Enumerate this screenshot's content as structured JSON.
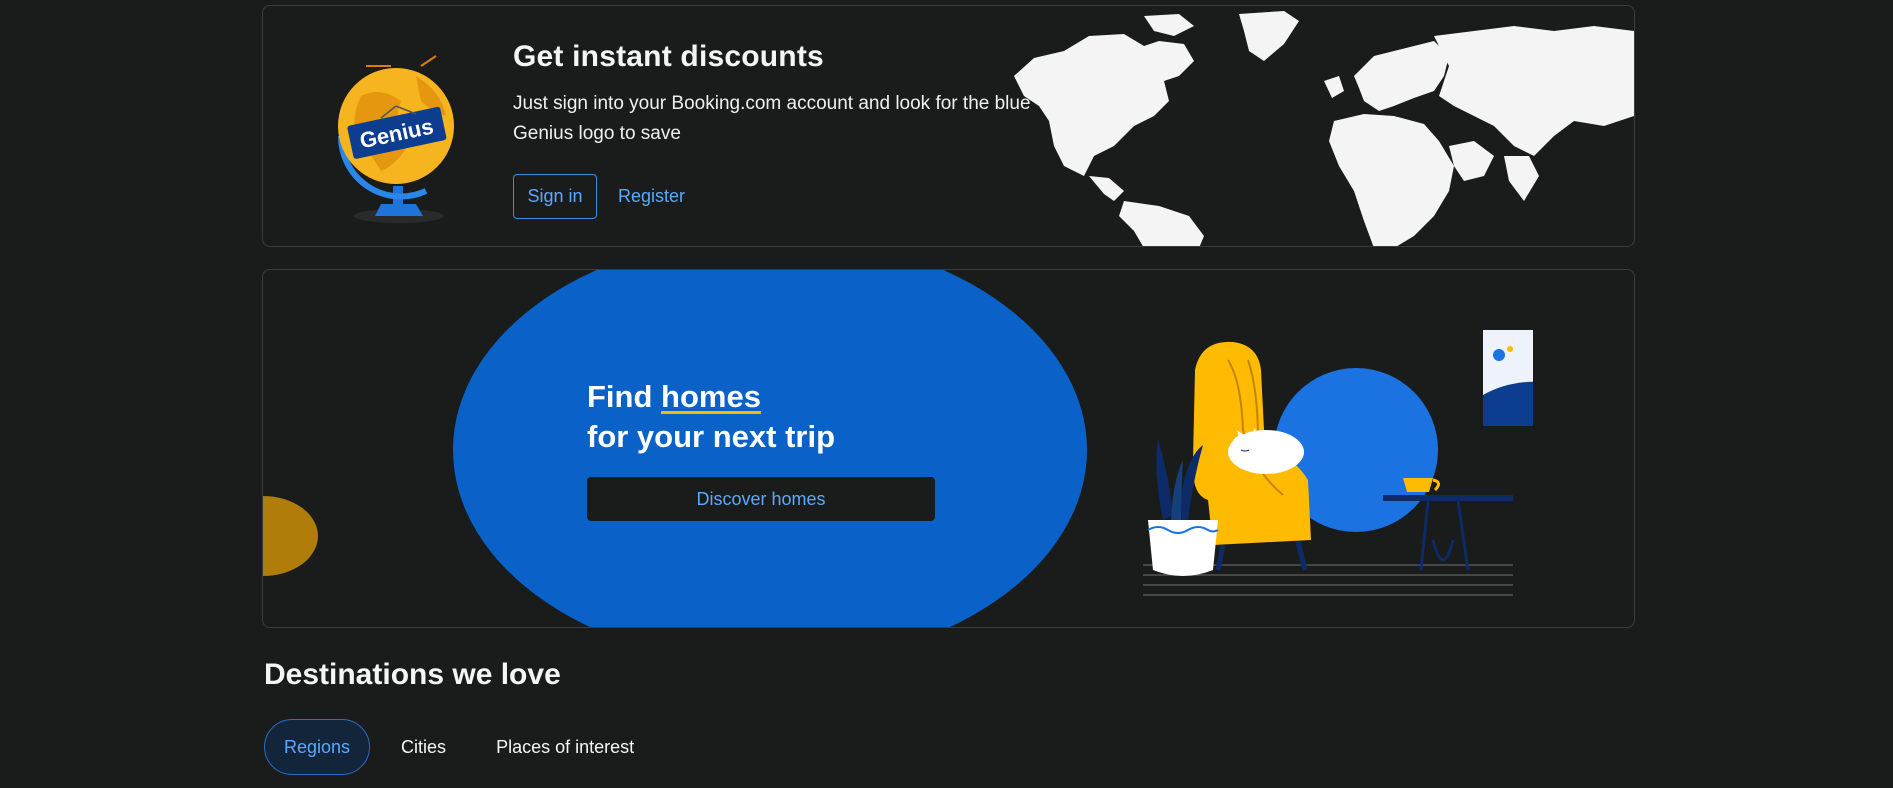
{
  "genius": {
    "title": "Get instant discounts",
    "description": "Just sign into your Booking.com account and look for the blue Genius logo to save",
    "globe_label": "Genius",
    "sign_in_label": "Sign in",
    "register_label": "Register"
  },
  "homes": {
    "title_prefix": "Find ",
    "title_highlight": "homes",
    "title_line2": "for your next trip",
    "discover_label": "Discover homes"
  },
  "destinations": {
    "title": "Destinations we love",
    "tabs": [
      {
        "label": "Regions",
        "active": true
      },
      {
        "label": "Cities",
        "active": false
      },
      {
        "label": "Places of interest",
        "active": false
      }
    ]
  },
  "colors": {
    "background": "#1a1c1c",
    "accent_blue": "#0a62c9",
    "link_blue": "#5aa9ff",
    "yellow": "#febb02"
  }
}
